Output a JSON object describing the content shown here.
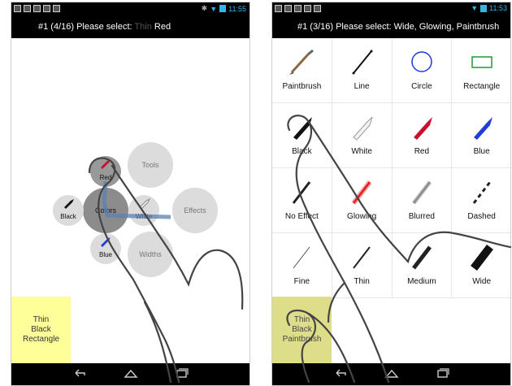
{
  "left": {
    "status": {
      "time": "11:55"
    },
    "title": {
      "prefix": "#1 (4/16) Please select: ",
      "faint": "Thin",
      "highlight": "Red"
    },
    "menu": {
      "tools": "Tools",
      "red": "Red",
      "black": "Black",
      "colors": "Colors",
      "white": "White",
      "effects": "Effects",
      "blue": "Blue",
      "widths": "Widths"
    },
    "result": [
      "Thin",
      "Black",
      "Rectangle"
    ]
  },
  "right": {
    "status": {
      "time": "11:53"
    },
    "title": "#1 (3/16) Please select: Wide, Glowing, Paintbrush",
    "cells": [
      {
        "label": "Paintbrush",
        "icon": "paintbrush-icon"
      },
      {
        "label": "Line",
        "icon": "line-icon"
      },
      {
        "label": "Circle",
        "icon": "circle-icon"
      },
      {
        "label": "Rectangle",
        "icon": "rectangle-icon"
      },
      {
        "label": "Black",
        "icon": "black-paint-tube-icon"
      },
      {
        "label": "White",
        "icon": "white-paint-tube-icon"
      },
      {
        "label": "Red",
        "icon": "red-paint-tube-icon"
      },
      {
        "label": "Blue",
        "icon": "blue-paint-tube-icon"
      },
      {
        "label": "No Effect",
        "icon": "no-effect-line-icon"
      },
      {
        "label": "Glowing",
        "icon": "glowing-line-icon"
      },
      {
        "label": "Blurred",
        "icon": "blurred-line-icon"
      },
      {
        "label": "Dashed",
        "icon": "dashed-line-icon"
      },
      {
        "label": "Fine",
        "icon": "fine-line-icon"
      },
      {
        "label": "Thin",
        "icon": "thin-line-icon"
      },
      {
        "label": "Medium",
        "icon": "medium-line-icon"
      },
      {
        "label": "Wide",
        "icon": "wide-line-icon"
      }
    ],
    "result": [
      "Thin",
      "Black",
      "Paintbrush"
    ]
  },
  "colors": {
    "red": "#c8102e",
    "blue": "#1f3dd9",
    "accent": "#33b5e5",
    "highlight_yellow": "#ffff99"
  }
}
